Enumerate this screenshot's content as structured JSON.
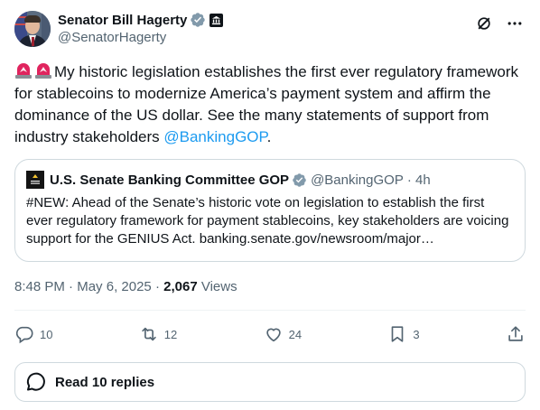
{
  "author": {
    "display_name": "Senator Bill Hagerty",
    "handle": "@SenatorHagerty"
  },
  "icons": {
    "verified": "verified-check-icon",
    "government": "government-building-icon",
    "grok": "grok-icon",
    "more": "more-dots-icon",
    "siren": "police-light-emoji",
    "reply": "reply-icon",
    "repost": "repost-icon",
    "like": "heart-icon",
    "bookmark": "bookmark-icon",
    "share": "share-icon",
    "replies": "chat-bubble-icon"
  },
  "tweet": {
    "text_main": "My historic legislation establishes the first ever regulatory framework for stablecoins to modernize America’s payment system and affirm the dominance of the US dollar. See the many statements of support from industry stakeholders ",
    "mention": "@BankingGOP",
    "text_end": "."
  },
  "quote": {
    "display_name": "U.S. Senate Banking Committee GOP",
    "handle": "@BankingGOP",
    "time": "· 4h",
    "avatar_text": "BANKING GOP",
    "text": "#NEW: Ahead of the Senate’s historic vote on legislation to establish the first ever regulatory framework for payment stablecoins, key stakeholders are voicing support for the GENIUS Act. banking.senate.gov/newsroom/major…"
  },
  "meta": {
    "time": "8:48 PM",
    "sep1": " · ",
    "date": "May 6, 2025",
    "sep2": " · ",
    "views_count": "2,067",
    "views_label": " Views"
  },
  "actions": {
    "replies": "10",
    "reposts": "12",
    "likes": "24",
    "bookmarks": "3"
  },
  "read_replies": "Read 10 replies",
  "colors": {
    "accent": "#1d9bf0",
    "text": "#0f1419",
    "secondary": "#536471",
    "border": "#cfd9de",
    "verified": "#829aab",
    "siren": "#e0245e"
  }
}
